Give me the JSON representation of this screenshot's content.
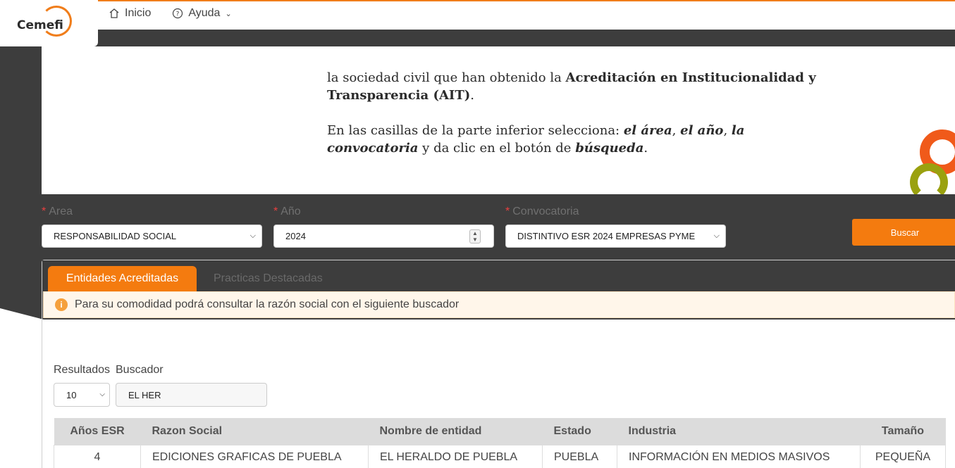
{
  "brand": {
    "name": "Cemefi",
    "accent": "#f47b0f"
  },
  "nav": {
    "home_label": "Inicio",
    "help_label": "Ayuda"
  },
  "intro": {
    "line1_pre": "la sociedad civil que han obtenido la ",
    "line1_bold": "Acreditación en Institucionalidad y Transparencia (AIT)",
    "line1_post": ".",
    "p2_pre": "En las casillas de la parte inferior selecciona: ",
    "p2_area": "el área",
    "p2_sep1": ", ",
    "p2_anio": "el año",
    "p2_sep2": ", ",
    "p2_conv": "la convocatoria",
    "p2_mid": " y da clic en el botón de ",
    "p2_busq": "búsqueda",
    "p2_end": "."
  },
  "filters": {
    "area_label": "Area",
    "area_value": "RESPONSABILIDAD SOCIAL",
    "year_label": "Año",
    "year_value": "2024",
    "conv_label": "Convocatoria",
    "conv_value": "DISTINTIVO ESR 2024 EMPRESAS PYME",
    "search_button": "Buscar"
  },
  "tabs": {
    "active": "Entidades Acreditadas",
    "inactive": "Practicas Destacadas"
  },
  "alert": {
    "text": "Para su comodidad podrá consultar la razón social con el siguiente buscador"
  },
  "search": {
    "results_label": "Resultados",
    "results_value": "10",
    "finder_label": "Buscador",
    "finder_value": "EL HER"
  },
  "table": {
    "headers": [
      "Años ESR",
      "Razon Social",
      "Nombre de entidad",
      "Estado",
      "Industria",
      "Tamaño"
    ],
    "rows": [
      [
        "4",
        "EDICIONES GRAFICAS DE PUEBLA",
        "EL HERALDO DE PUEBLA",
        "PUEBLA",
        "INFORMACIÓN EN MEDIOS MASIVOS",
        "PEQUEÑA"
      ]
    ]
  }
}
